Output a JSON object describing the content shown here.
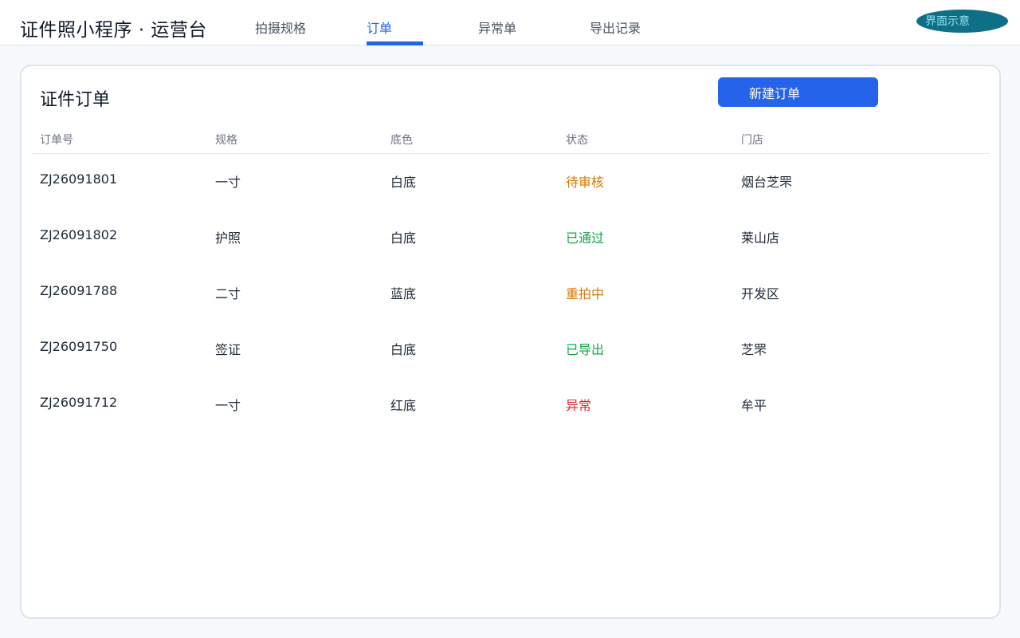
{
  "app": {
    "title": "证件照小程序 · 运营台",
    "badge": "界面示意"
  },
  "nav": {
    "tabs": [
      {
        "label": "拍摄规格",
        "active": false
      },
      {
        "label": "订单",
        "active": true
      },
      {
        "label": "异常单",
        "active": false
      },
      {
        "label": "导出记录",
        "active": false
      }
    ]
  },
  "orders": {
    "title": "证件订单",
    "new_button": "新建订单",
    "columns": [
      "订单号",
      "规格",
      "底色",
      "状态",
      "门店"
    ],
    "rows": [
      {
        "id": "ZJ26091801",
        "spec": "一寸",
        "bg": "白底",
        "status": "待审核",
        "store": "烟台芝罘"
      },
      {
        "id": "ZJ26091802",
        "spec": "护照",
        "bg": "白底",
        "status": "已通过",
        "store": "莱山店"
      },
      {
        "id": "ZJ26091788",
        "spec": "二寸",
        "bg": "蓝底",
        "status": "重拍中",
        "store": "开发区"
      },
      {
        "id": "ZJ26091750",
        "spec": "签证",
        "bg": "白底",
        "status": "已导出",
        "store": "芝罘"
      },
      {
        "id": "ZJ26091712",
        "spec": "一寸",
        "bg": "红底",
        "status": "异常",
        "store": "牟平"
      }
    ]
  },
  "colors": {
    "accent": "#2563eb",
    "status_pending": "#d97706",
    "status_ok": "#16a34a",
    "status_error": "#dc2626",
    "badge_bg": "#0f6f86"
  }
}
